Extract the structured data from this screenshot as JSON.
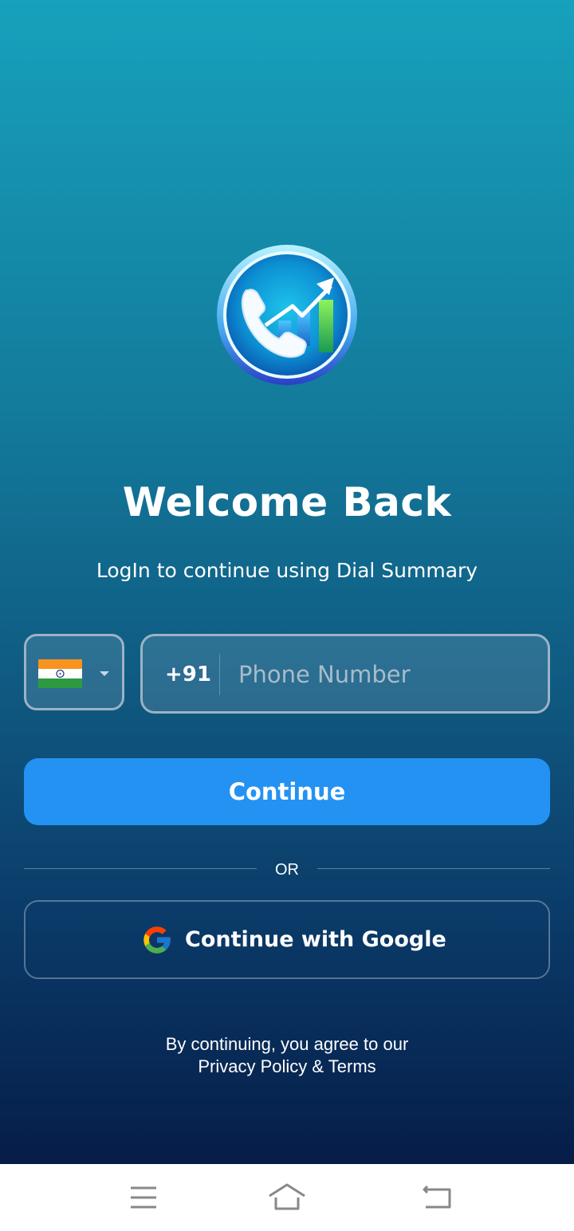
{
  "welcome": {
    "title": "Welcome Back",
    "subtitle": "LogIn to continue using Dial Summary"
  },
  "country_selector": {
    "flag_icon": "india-flag-icon",
    "caret_icon": "chevron-down-icon"
  },
  "phone": {
    "dial_code": "+91",
    "placeholder": "Phone Number",
    "value": ""
  },
  "buttons": {
    "continue_label": "Continue",
    "google_label": "Continue with Google"
  },
  "separator": {
    "or_label": "OR"
  },
  "terms": {
    "line1": "By continuing, you agree to our",
    "privacy_link": "Privacy Policy",
    "conjunction": " & ",
    "terms_link": "Terms"
  },
  "navbar": {
    "menu_icon": "menu-icon",
    "home_icon": "home-icon",
    "back_icon": "back-icon"
  },
  "colors": {
    "primary_button": "#2492f2",
    "gradient_top": "#17a1bc",
    "gradient_bottom": "#061d48"
  }
}
